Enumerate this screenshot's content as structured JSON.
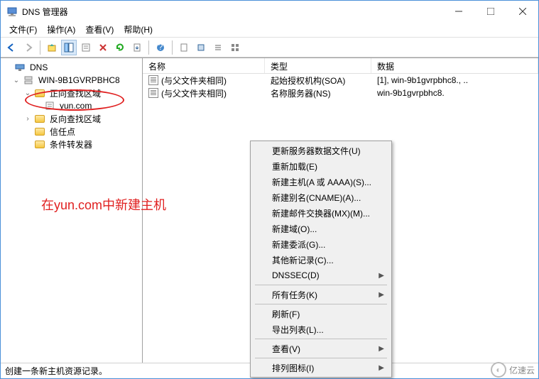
{
  "window": {
    "title": "DNS 管理器"
  },
  "menu": {
    "file": "文件(F)",
    "action": "操作(A)",
    "view": "查看(V)",
    "help": "帮助(H)"
  },
  "tree": {
    "root": "DNS",
    "server": "WIN-9B1GVRPBHC8",
    "fwd": "正向查找区域",
    "zone": "yun.com",
    "rev": "反向查找区域",
    "trust": "信任点",
    "cond": "条件转发器"
  },
  "list": {
    "hdr": {
      "name": "名称",
      "type": "类型",
      "data": "数据"
    },
    "rows": [
      {
        "name": "(与父文件夹相同)",
        "type": "起始授权机构(SOA)",
        "data": "[1], win-9b1gvrpbhc8., .."
      },
      {
        "name": "(与父文件夹相同)",
        "type": "名称服务器(NS)",
        "data": "win-9b1gvrpbhc8."
      }
    ]
  },
  "ctx": {
    "update": "更新服务器数据文件(U)",
    "reload": "重新加载(E)",
    "newhost": "新建主机(A 或 AAAA)(S)...",
    "newalias": "新建别名(CNAME)(A)...",
    "newmx": "新建邮件交换器(MX)(M)...",
    "newdomain": "新建域(O)...",
    "newdeleg": "新建委派(G)...",
    "other": "其他新记录(C)...",
    "dnssec": "DNSSEC(D)",
    "alltasks": "所有任务(K)",
    "refresh": "刷新(F)",
    "export": "导出列表(L)...",
    "viewm": "查看(V)",
    "arrange": "排列图标(I)"
  },
  "status": "创建一条新主机资源记录。",
  "annotation": "在yun.com中新建主机",
  "watermark": "亿速云"
}
